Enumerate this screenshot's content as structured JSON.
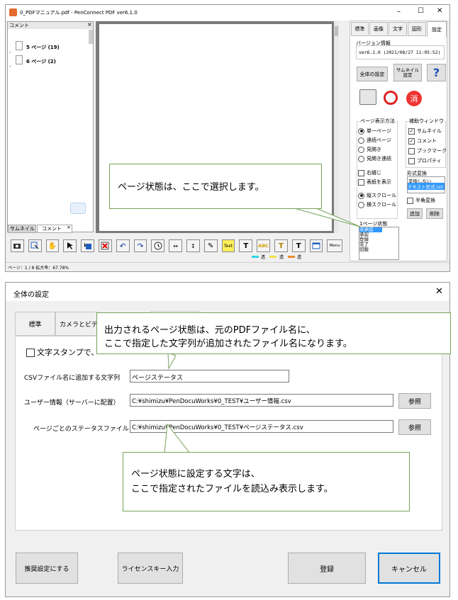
{
  "app": {
    "title": "0_PDFマニュアル.pdf - PenConnect PDF ver6.1.0",
    "window_controls": {
      "minimize": "–",
      "maximize": "☐",
      "close": "✕"
    },
    "comment_panel": {
      "title": "コメント",
      "close": "×",
      "items": [
        {
          "label": "5 ページ (19)"
        },
        {
          "label": "6 ページ (2)"
        }
      ],
      "bottom_tabs": [
        {
          "label": "サムネイル"
        },
        {
          "label": "コメント"
        }
      ]
    },
    "right_panel": {
      "tabs": [
        "標準",
        "画像",
        "文字",
        "図形",
        "設定"
      ],
      "version_group": "バージョン情報",
      "version_text": "ver6.1.0 (2021/08/27 11:05:52)",
      "buttons": {
        "global_settings": "全体の設定",
        "thumbnail_settings": "サムネイル 設定",
        "help": "?"
      },
      "page_display": {
        "title": "ページ表示方法",
        "options": [
          "単一ページ",
          "連続ページ",
          "見開き",
          "見開き連続"
        ],
        "selected": "単一ページ",
        "checks": [
          {
            "label": "右綴じ",
            "checked": false
          },
          {
            "label": "表紙を表示",
            "checked": false
          }
        ],
        "scroll_options": [
          "縦スクロール",
          "横スクロール"
        ],
        "scroll_selected": "縦スクロール"
      },
      "aux_window": {
        "title": "補助ウィンドウ",
        "items": [
          {
            "label": "サムネイル",
            "checked": true
          },
          {
            "label": "コメント",
            "checked": true
          },
          {
            "label": "ブックマーク",
            "checked": false
          },
          {
            "label": "プロパティ",
            "checked": false
          }
        ]
      },
      "format_convert": {
        "title": "形式変換",
        "options": [
          "変換しない",
          "テキスト形式.txt"
        ],
        "selected": "テキスト形式.txt",
        "halfwidth": "半角変換"
      },
      "page_state": {
        "title": "1ページ状態",
        "items": [
          "未承認",
          "承認",
          "登録",
          "完了",
          "旧版"
        ],
        "add": "追加",
        "delete": "削除"
      }
    },
    "toolbar": {
      "text_button": "Text",
      "abc_button": "ABC",
      "menu_button": "Menu",
      "pen_labels": [
        "透",
        "透",
        "透"
      ]
    },
    "status": {
      "text": "ページ：1 / 8   拡大率：67.78%"
    },
    "callout": "ページ状態は、ここで選択します。"
  },
  "dialog": {
    "title": "全体の設定",
    "close": "✕",
    "tabs": [
      "標準",
      "カメラとビデオ",
      "",
      ""
    ],
    "stamp_checkbox": "文字スタンプで、ー",
    "fields": {
      "csv_suffix": {
        "label": "CSVファイル名に追加する文字列",
        "value": "ページステータス"
      },
      "user_info": {
        "label": "ユーザー情報（サーバーに配置）",
        "value": "C:¥shimizu¥PenDocuWorks¥0_TEST¥ユーザー情報.csv",
        "browse": "参照"
      },
      "status_file": {
        "label": "ページごとのステータスファイル",
        "value": "C:¥shimizu¥PenDocuWorks¥0_TEST¥ページステータス.csv",
        "browse": "参照"
      }
    },
    "buttons": {
      "recommended": "推奨設定にする",
      "license": "ライセンスキー入力",
      "register": "登録",
      "cancel": "キャンセル"
    },
    "callout_top": [
      "出力されるページ状態は、元のPDFファイル名に、",
      "ここで指定した文字列が追加されたファイル名になります。"
    ],
    "callout_bottom": [
      "ページ状態に設定する文字は、",
      "ここで指定されたファイルを読込み表示します。"
    ]
  },
  "colors": {
    "callout_border": "#77a35c",
    "accent_blue": "#0078d7",
    "selection": "#3399ff"
  }
}
